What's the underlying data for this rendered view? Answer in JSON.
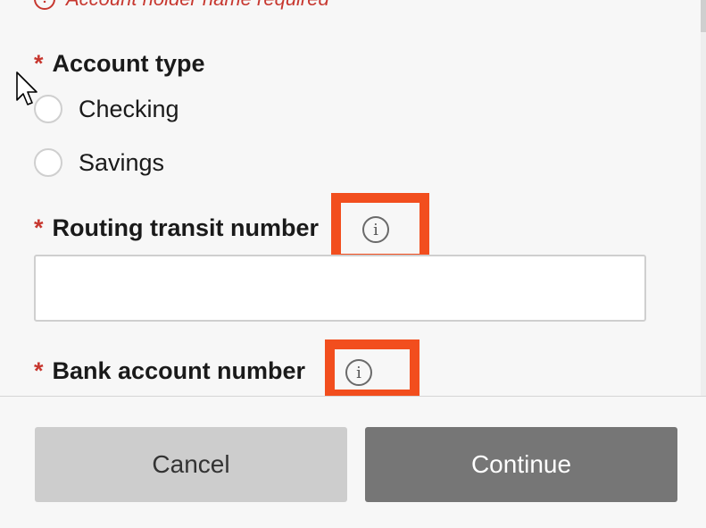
{
  "error": {
    "message": "Account holder name required",
    "icon": "!"
  },
  "required_marker": "*",
  "account_type": {
    "label": "Account type",
    "options": [
      {
        "label": "Checking",
        "selected": false
      },
      {
        "label": "Savings",
        "selected": false
      }
    ]
  },
  "routing": {
    "label": "Routing transit number",
    "value": "",
    "info_glyph": "i"
  },
  "bank_account": {
    "label": "Bank account number",
    "info_glyph": "i"
  },
  "footer": {
    "cancel_label": "Cancel",
    "continue_label": "Continue"
  },
  "colors": {
    "required": "#c7372f",
    "highlight": "#f24e1e",
    "primary_button": "#767676",
    "secondary_button": "#cdcdcd"
  }
}
